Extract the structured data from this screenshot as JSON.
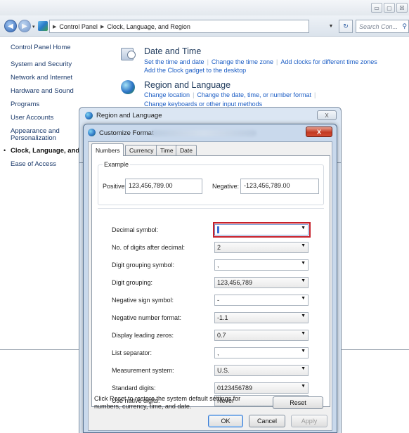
{
  "window": {
    "title_controls": {
      "minimize": "▭",
      "maximize": "▢",
      "close": "☒"
    }
  },
  "navbar": {
    "breadcrumb": [
      "Control Panel",
      "Clock, Language, and Region"
    ],
    "search_placeholder": "Search Con...",
    "refresh_glyph": "↻",
    "dropdown_glyph": "▼"
  },
  "sidebar": {
    "items": [
      "Control Panel Home",
      "System and Security",
      "Network and Internet",
      "Hardware and Sound",
      "Programs",
      "User Accounts",
      "Appearance and",
      "Personalization",
      "Clock, Language, and",
      "Ease of Access"
    ],
    "current_bullet": "•"
  },
  "categories": {
    "date_time": {
      "title": "Date and Time",
      "links": [
        "Set the time and date",
        "Change the time zone",
        "Add clocks for different time zones",
        "Add the Clock gadget to the desktop"
      ]
    },
    "region_language": {
      "title": "Region and Language",
      "links": [
        "Change location",
        "Change the date, time, or number format",
        "Change keyboards or other input methods"
      ]
    }
  },
  "region_dialog": {
    "title": "Region and Language",
    "close": "X"
  },
  "customize_dialog": {
    "title": "Customize Format",
    "close": "X",
    "tabs": [
      "Numbers",
      "Currency",
      "Time",
      "Date"
    ],
    "active_tab": "Numbers",
    "example": {
      "group_label": "Example",
      "positive_label": "Positive:",
      "positive_value": "123,456,789.00",
      "negative_label": "Negative:",
      "negative_value": "-123,456,789.00"
    },
    "rows": [
      {
        "label": "Decimal symbol:",
        "value": ""
      },
      {
        "label": "No. of digits after decimal:",
        "value": "2"
      },
      {
        "label": "Digit grouping symbol:",
        "value": ","
      },
      {
        "label": "Digit grouping:",
        "value": "123,456,789"
      },
      {
        "label": "Negative sign symbol:",
        "value": "-"
      },
      {
        "label": "Negative number format:",
        "value": "-1.1"
      },
      {
        "label": "Display leading zeros:",
        "value": "0.7"
      },
      {
        "label": "List separator:",
        "value": ","
      },
      {
        "label": "Measurement system:",
        "value": "U.S."
      },
      {
        "label": "Standard digits:",
        "value": "0123456789"
      },
      {
        "label": "Use native digits:",
        "value": "Never"
      }
    ],
    "reset_note": "Click Reset to restore the system default settings for numbers, currency, time, and date.",
    "reset_label": "Reset",
    "ok_label": "OK",
    "cancel_label": "Cancel",
    "apply_label": "Apply",
    "dropdown_glyph": "▼"
  },
  "colors": {
    "highlight": "#c7202b",
    "link": "#1a5cc4",
    "close_red": "#c23a22"
  }
}
